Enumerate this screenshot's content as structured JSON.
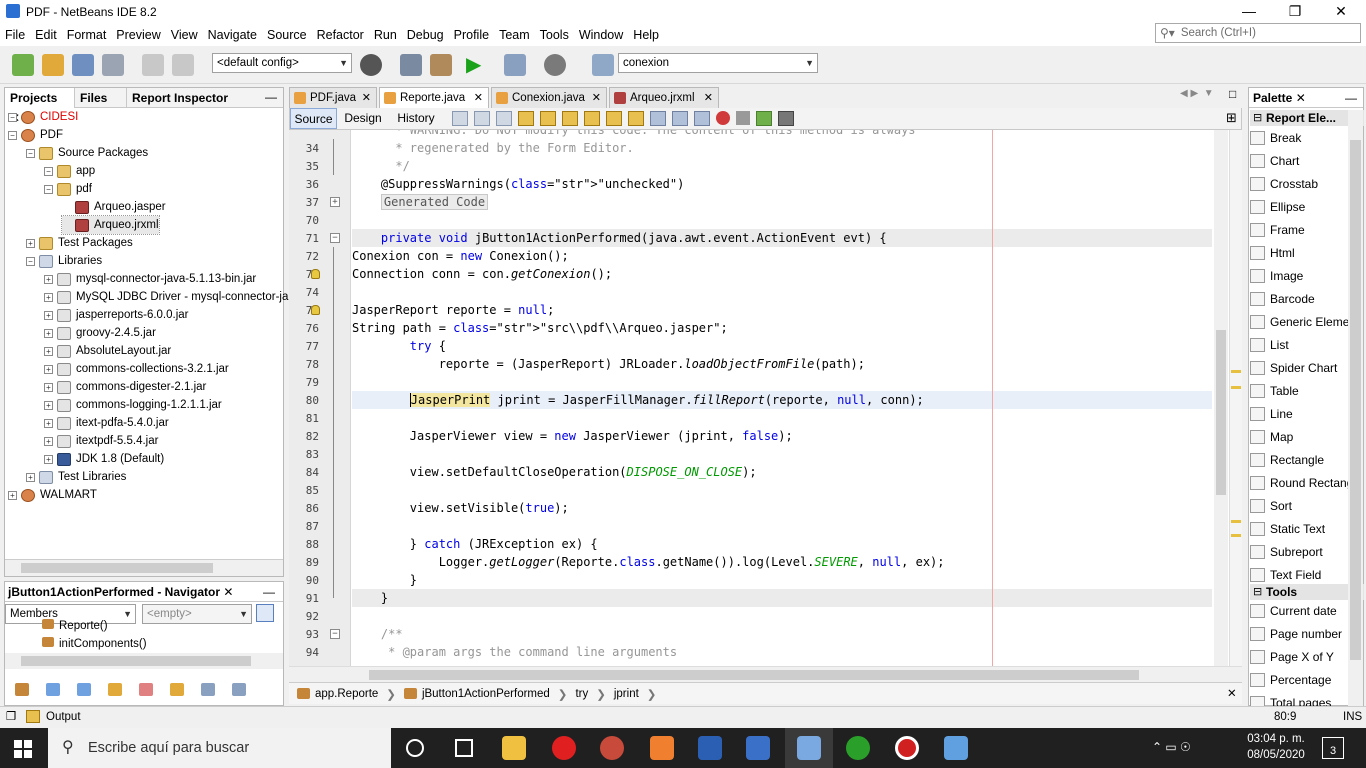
{
  "window": {
    "title": "PDF - NetBeans IDE 8.2"
  },
  "menu": [
    "File",
    "Edit",
    "Format",
    "Preview",
    "View",
    "Navigate",
    "Source",
    "Refactor",
    "Run",
    "Debug",
    "Profile",
    "Team",
    "Tools",
    "Window",
    "Help"
  ],
  "search": {
    "placeholder": "Search (Ctrl+I)"
  },
  "toolbar": {
    "config": "<default config>",
    "connection": "conexion"
  },
  "projects_panel": {
    "tabs": [
      "Projects",
      "Files",
      "Report Inspector"
    ],
    "tree": [
      {
        "label": "CIDESI",
        "indent": 0,
        "icon": "project-icon",
        "red": true
      },
      {
        "label": "PDF",
        "indent": 0,
        "icon": "project-icon"
      },
      {
        "label": "Source Packages",
        "indent": 1,
        "icon": "package-icon"
      },
      {
        "label": "app",
        "indent": 2,
        "icon": "package-icon"
      },
      {
        "label": "pdf",
        "indent": 2,
        "icon": "package-icon"
      },
      {
        "label": "Arqueo.jasper",
        "indent": 3,
        "icon": "report-icon"
      },
      {
        "label": "Arqueo.jrxml",
        "indent": 3,
        "icon": "report-icon",
        "selected": true
      },
      {
        "label": "Test Packages",
        "indent": 1,
        "icon": "package-icon"
      },
      {
        "label": "Libraries",
        "indent": 1,
        "icon": "library-icon"
      },
      {
        "label": "mysql-connector-java-5.1.13-bin.jar",
        "indent": 2,
        "icon": "jar-icon"
      },
      {
        "label": "MySQL JDBC Driver - mysql-connector-ja",
        "indent": 2,
        "icon": "jar-icon"
      },
      {
        "label": "jasperreports-6.0.0.jar",
        "indent": 2,
        "icon": "jar-icon"
      },
      {
        "label": "groovy-2.4.5.jar",
        "indent": 2,
        "icon": "jar-icon"
      },
      {
        "label": "AbsoluteLayout.jar",
        "indent": 2,
        "icon": "jar-icon"
      },
      {
        "label": "commons-collections-3.2.1.jar",
        "indent": 2,
        "icon": "jar-icon"
      },
      {
        "label": "commons-digester-2.1.jar",
        "indent": 2,
        "icon": "jar-icon"
      },
      {
        "label": "commons-logging-1.2.1.1.jar",
        "indent": 2,
        "icon": "jar-icon"
      },
      {
        "label": "itext-pdfa-5.4.0.jar",
        "indent": 2,
        "icon": "jar-icon"
      },
      {
        "label": "itextpdf-5.5.4.jar",
        "indent": 2,
        "icon": "jar-icon"
      },
      {
        "label": "JDK 1.8 (Default)",
        "indent": 2,
        "icon": "jdk-icon"
      },
      {
        "label": "Test Libraries",
        "indent": 1,
        "icon": "library-icon"
      },
      {
        "label": "WALMART",
        "indent": 0,
        "icon": "project-icon"
      }
    ]
  },
  "navigator": {
    "title": "jButton1ActionPerformed - Navigator",
    "members": "Members",
    "filter": "<empty>",
    "items": [
      "Reporte()",
      "initComponents()"
    ]
  },
  "editor": {
    "tabs": [
      "PDF.java",
      "Reporte.java",
      "Conexion.java",
      "Arqueo.jrxml"
    ],
    "subtabs": [
      "Source",
      "Design",
      "History"
    ],
    "lines": [
      {
        "n": "",
        "t": "      * WARNING: Do NOT modify this code. The content of this method is always",
        "c": "cm"
      },
      {
        "n": "34",
        "t": "      * regenerated by the Form Editor.",
        "c": "cm"
      },
      {
        "n": "35",
        "t": "      */",
        "c": "cm"
      },
      {
        "n": "36",
        "t": "    @SuppressWarnings(\"unchecked\")",
        "c": ""
      },
      {
        "n": "37",
        "t": "    Generated Code",
        "c": "gen"
      },
      {
        "n": "70",
        "t": "",
        "c": ""
      },
      {
        "n": "71",
        "t": "    private void jButton1ActionPerformed(java.awt.event.ActionEvent evt) {",
        "c": ""
      },
      {
        "n": "72",
        "t": "Conexion con = new Conexion();",
        "c": ""
      },
      {
        "n": "73",
        "t": "Connection conn = con.getConexion();",
        "c": ""
      },
      {
        "n": "74",
        "t": "",
        "c": ""
      },
      {
        "n": "75",
        "t": "JasperReport reporte = null;",
        "c": ""
      },
      {
        "n": "76",
        "t": "String path = \"src\\\\pdf\\\\Arqueo.jasper\";",
        "c": ""
      },
      {
        "n": "77",
        "t": "        try {",
        "c": ""
      },
      {
        "n": "78",
        "t": "            reporte = (JasperReport) JRLoader.loadObjectFromFile(path);",
        "c": ""
      },
      {
        "n": "79",
        "t": "",
        "c": ""
      },
      {
        "n": "80",
        "t": "        JasperPrint jprint = JasperFillManager.fillReport(reporte, null, conn);",
        "c": ""
      },
      {
        "n": "81",
        "t": "",
        "c": ""
      },
      {
        "n": "82",
        "t": "        JasperViewer view = new JasperViewer (jprint, false);",
        "c": ""
      },
      {
        "n": "83",
        "t": "",
        "c": ""
      },
      {
        "n": "84",
        "t": "        view.setDefaultCloseOperation(DISPOSE_ON_CLOSE);",
        "c": ""
      },
      {
        "n": "85",
        "t": "",
        "c": ""
      },
      {
        "n": "86",
        "t": "        view.setVisible(true);",
        "c": ""
      },
      {
        "n": "87",
        "t": "",
        "c": ""
      },
      {
        "n": "88",
        "t": "        } catch (JRException ex) {",
        "c": ""
      },
      {
        "n": "89",
        "t": "            Logger.getLogger(Reporte.class.getName()).log(Level.SEVERE, null, ex);",
        "c": ""
      },
      {
        "n": "90",
        "t": "        }",
        "c": ""
      },
      {
        "n": "91",
        "t": "    }",
        "c": ""
      },
      {
        "n": "92",
        "t": "",
        "c": ""
      },
      {
        "n": "93",
        "t": "    /**",
        "c": "cm"
      },
      {
        "n": "94",
        "t": "     * @param args the command line arguments",
        "c": "cm"
      }
    ],
    "breadcrumb": [
      "app.Reporte",
      "jButton1ActionPerformed",
      "try",
      "jprint"
    ]
  },
  "palette": {
    "title": "Palette",
    "section1": "Report Ele...",
    "items1": [
      "Break",
      "Chart",
      "Crosstab",
      "Ellipse",
      "Frame",
      "Html",
      "Image",
      "Barcode",
      "Generic Elemen",
      "List",
      "Spider Chart",
      "Table",
      "Line",
      "Map",
      "Rectangle",
      "Round Rectang",
      "Sort",
      "Static Text",
      "Subreport",
      "Text Field"
    ],
    "section2": "Tools",
    "items2": [
      "Current date",
      "Page number",
      "Page X of Y",
      "Percentage",
      "Total pages"
    ]
  },
  "statusbar": {
    "output": "Output",
    "position": "80:9",
    "mode": "INS"
  },
  "taskbar": {
    "search": "Escribe aquí para buscar",
    "time": "03:04 p. m.",
    "date": "08/05/2020",
    "notifications": "3"
  },
  "colors": {
    "accent": "#3d6fd6",
    "keyword": "#0000e6",
    "string": "#ce7b00",
    "comment": "#969696"
  }
}
